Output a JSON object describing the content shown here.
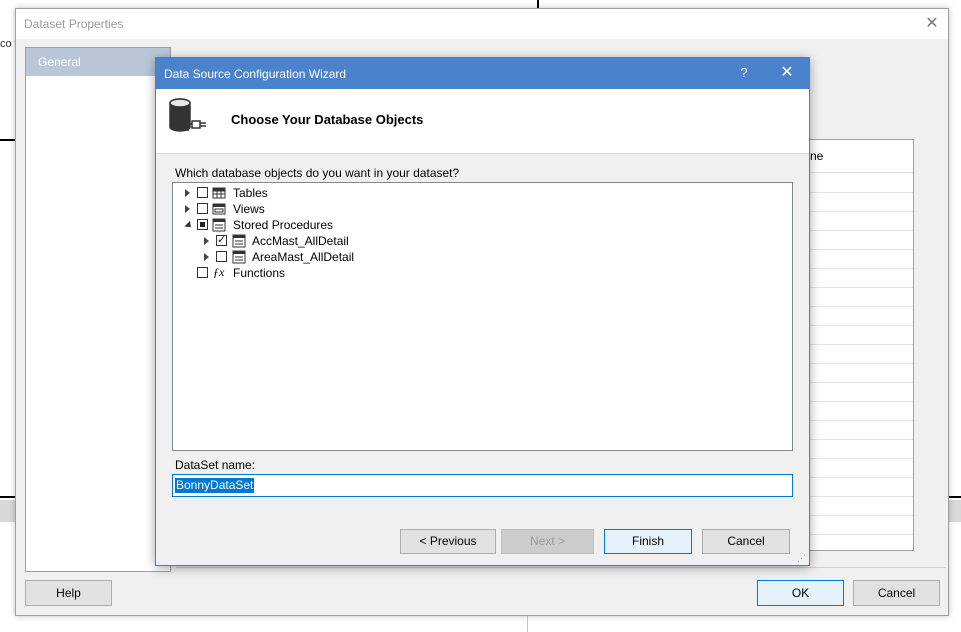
{
  "background": {
    "fragment_text": "co t"
  },
  "outer_dialog": {
    "title": "Dataset Properties",
    "close_glyph": "✕",
    "nav": {
      "general_label": "General"
    },
    "grid_header_fragment": "ne",
    "buttons": {
      "help": "Help",
      "ok": "OK",
      "cancel": "Cancel"
    }
  },
  "wizard": {
    "title": "Data Source Configuration Wizard",
    "help_glyph": "?",
    "close_glyph": "✕",
    "header_title": "Choose Your Database Objects",
    "question": "Which database objects do you want in your dataset?",
    "tree": [
      {
        "label": "Tables",
        "expander": "collapsed",
        "check": "unchecked",
        "icon": "table-icon"
      },
      {
        "label": "Views",
        "expander": "collapsed",
        "check": "unchecked",
        "icon": "view-icon"
      },
      {
        "label": "Stored Procedures",
        "expander": "expanded",
        "check": "partial",
        "icon": "stored-procedure-icon"
      },
      {
        "label": "AccMast_AllDetail",
        "expander": "collapsed",
        "check": "checked",
        "icon": "stored-procedure-icon"
      },
      {
        "label": "AreaMast_AllDetail",
        "expander": "collapsed",
        "check": "unchecked",
        "icon": "stored-procedure-icon"
      },
      {
        "label": "Functions",
        "expander": "none",
        "check": "unchecked",
        "icon": "function-icon"
      }
    ],
    "dataset_name_label": "DataSet name:",
    "dataset_name_value": "BonnyDataSet",
    "buttons": {
      "previous": "< Previous",
      "next": "Next >",
      "finish": "Finish",
      "cancel": "Cancel"
    }
  },
  "colors": {
    "wizard_title_bar": "#4a82cc",
    "accent": "#0078d7",
    "nav_selected": "#b9c6d8"
  }
}
